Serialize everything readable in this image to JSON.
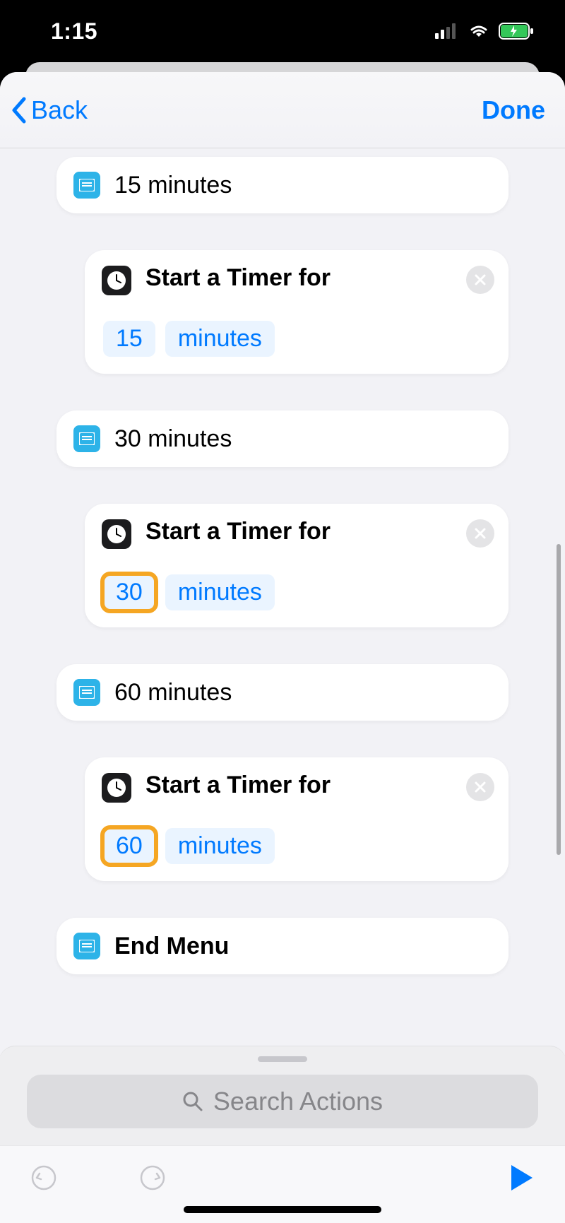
{
  "status": {
    "time": "1:15"
  },
  "nav": {
    "back_label": "Back",
    "done_label": "Done"
  },
  "blocks": {
    "option15": {
      "label": "15 minutes"
    },
    "timer15": {
      "title": "Start a Timer for",
      "value": "15",
      "unit": "minutes"
    },
    "option30": {
      "label": "30 minutes"
    },
    "timer30": {
      "title": "Start a Timer for",
      "value": "30",
      "unit": "minutes"
    },
    "option60": {
      "label": "60 minutes"
    },
    "timer60": {
      "title": "Start a Timer for",
      "value": "60",
      "unit": "minutes"
    },
    "end_menu": {
      "label": "End Menu"
    }
  },
  "search": {
    "placeholder": "Search Actions"
  }
}
